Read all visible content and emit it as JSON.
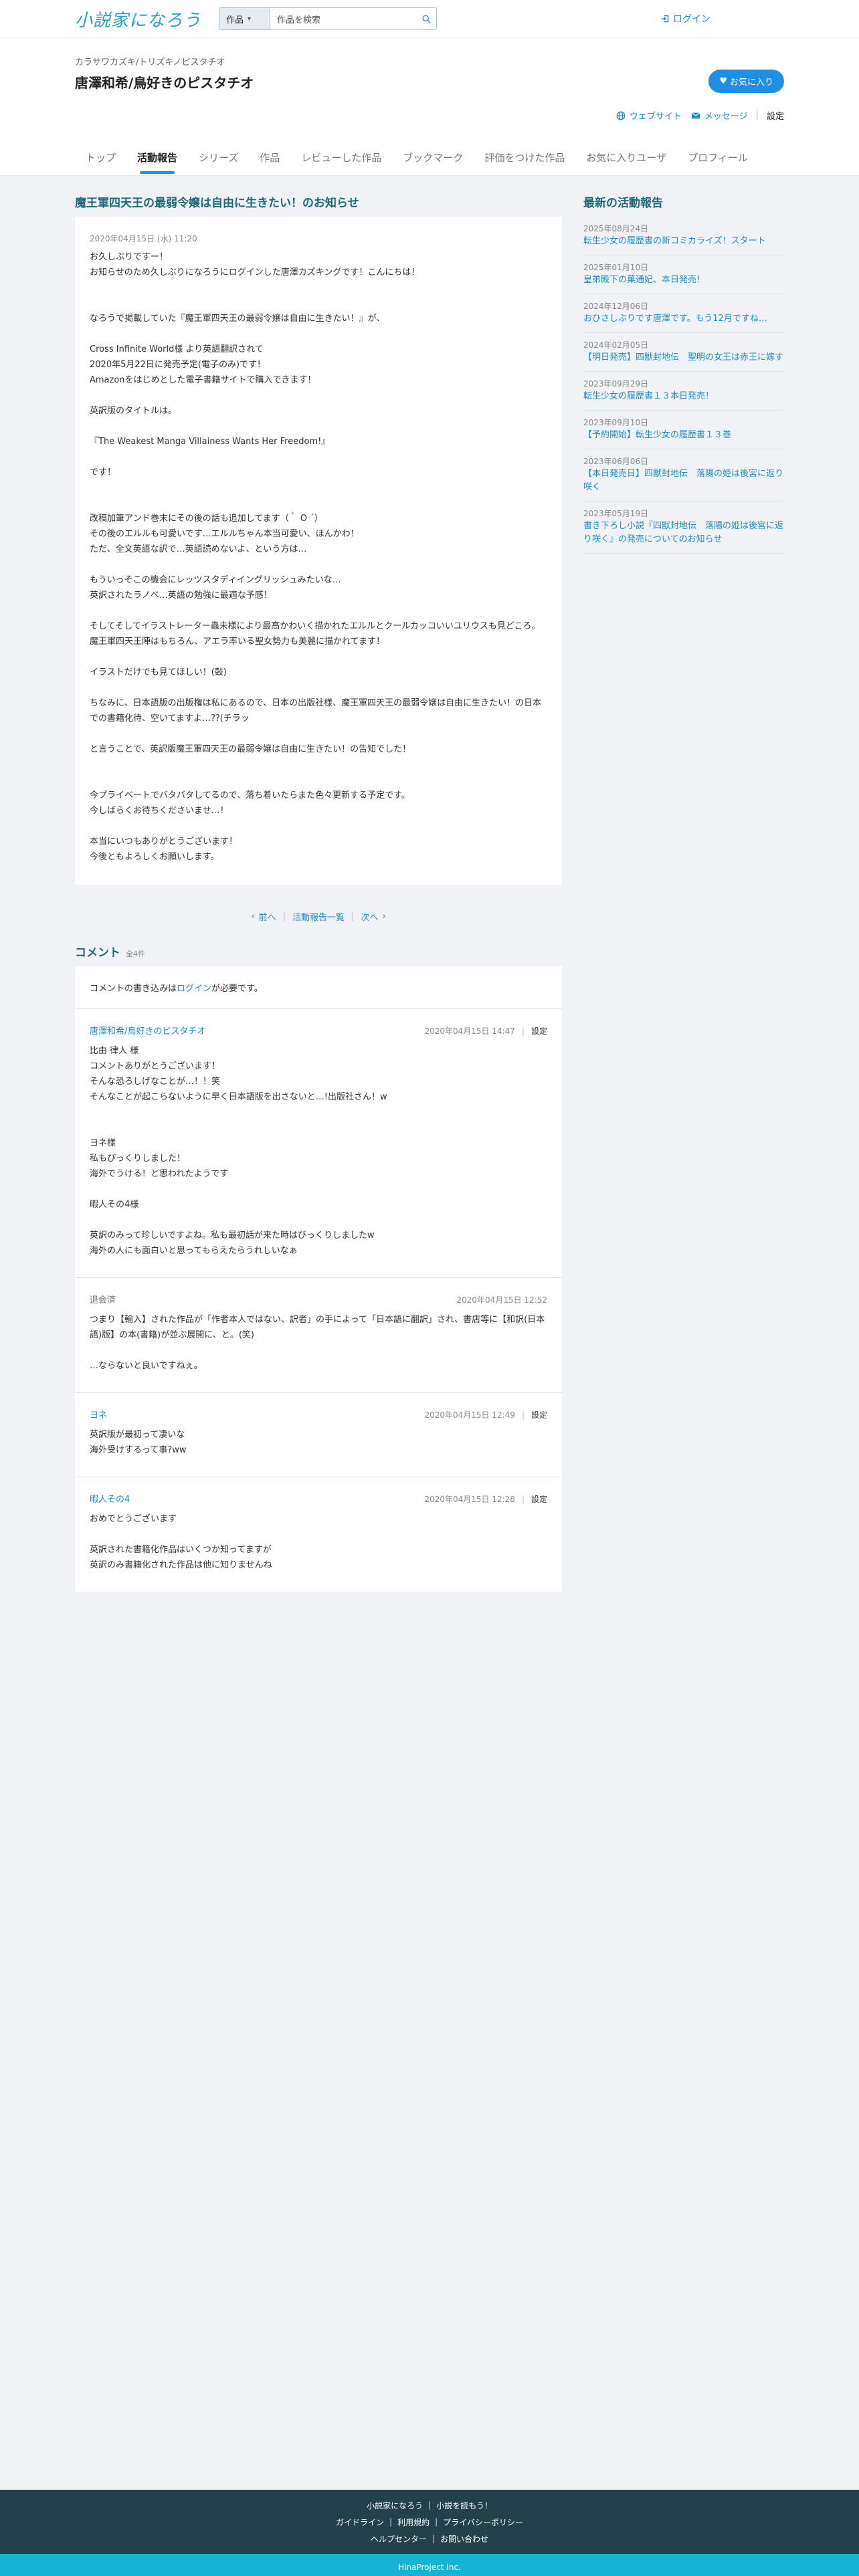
{
  "header": {
    "logo_small": "小説家",
    "logo_text": "小説家になろう",
    "search_category": "作品",
    "search_placeholder": "作品を検索",
    "login_label": "ログイン"
  },
  "user": {
    "ruby": "カラサワカズキ/トリズキノピスタチオ",
    "name": "唐澤和希/鳥好きのピスタチオ",
    "fav_label": "お気に入り",
    "website_label": "ウェブサイト",
    "message_label": "メッセージ",
    "settings_label": "設定",
    "tabs": [
      {
        "label": "トップ",
        "active": false
      },
      {
        "label": "活動報告",
        "active": true
      },
      {
        "label": "シリーズ",
        "active": false
      },
      {
        "label": "作品",
        "active": false
      },
      {
        "label": "レビューした作品",
        "active": false
      },
      {
        "label": "ブックマーク",
        "active": false
      },
      {
        "label": "評価をつけた作品",
        "active": false
      },
      {
        "label": "お気に入りユーザ",
        "active": false
      },
      {
        "label": "プロフィール",
        "active": false
      }
    ]
  },
  "report": {
    "title": "魔王軍四天王の最弱令嬢は自由に生きたい！のお知らせ",
    "date": "2020年04月15日 (水) 11:20",
    "lines": [
      "お久しぶりですー！",
      "お知らせのため久しぶりになろうにログインした唐澤カズキングです！こんにちは！",
      "",
      "",
      "なろうで掲載していた『魔王軍四天王の最弱令嬢は自由に生きたい！』が、",
      "",
      "Cross Infinite World様 より英語翻訳されて",
      "2020年5月22日に発売予定(電子のみ)です！",
      "Amazonをはじめとした電子書籍サイトで購入できます！",
      "",
      "英訳版のタイトルは。",
      "",
      "『The Weakest Manga Villainess Wants Her Freedom!』",
      "",
      "です！",
      "",
      "",
      "改稿加筆アンド巻末にその後の話も追加してます（｀ O ´）",
      "その後のエルルも可愛いです…エルルちゃん本当可愛い、ほんかわ！",
      "ただ、全文英語な訳で…英語読めないよ、という方は…",
      "",
      "もういっそこの機会にレッツスタディイングリッシュみたいな…",
      "英訳されたラノベ…英語の勉強に最適な予感！",
      "",
      "そしてそしてイラストレーター蟲未様により最高かわいく描かれたエルルとクールカッコいいユリウスも見どころ。",
      "魔王軍四天王陣はもちろん、アエラ率いる聖女勢力も美麗に描かれてます！",
      "",
      "イラストだけでも見てほしい！(鼓)",
      "",
      "ちなみに、日本語版の出版権は私にあるので、日本の出版社様、魔王軍四天王の最弱令嬢は自由に生きたい！の日本での書籍化待、空いてますよ…??(チラッ",
      "",
      "と言うことで、英訳版魔王軍四天王の最弱令嬢は自由に生きたい！の告知でした！",
      "",
      "",
      "今プライベートでバタバタしてるので、落ち着いたらまた色々更新する予定です。",
      "今しばらくお待ちくださいませ…！",
      "",
      "本当にいつもありがとうございます！",
      "今後ともよろしくお願いします。"
    ]
  },
  "pager": {
    "prev": "前へ",
    "list": "活動報告一覧",
    "next": "次へ"
  },
  "comments": {
    "title": "コメント",
    "count": "全4件",
    "notice_before": "コメントの書き込みは",
    "notice_link": "ログイン",
    "notice_after": "が必要です。",
    "items": [
      {
        "author": "唐澤和希/鳥好きのピスタチオ",
        "date": "2020年04月15日 14:47",
        "settings": "設定",
        "lines": [
          "比由 律人 様",
          "コメントありがとうございます！",
          "そんな恐ろしげなことが…！！笑",
          "そんなことが起こらないように早く日本語版を出さないと…!出版社さん！w",
          "",
          "",
          "ヨネ様",
          "私もびっくりしました！",
          "海外でうける！と思われたようです",
          "",
          "暇人その4様",
          "",
          "英訳のみって珍しいですよね。私も最初話が来た時はびっくりしましたw",
          "海外の人にも面白いと思ってもらえたらうれしいなぁ"
        ]
      },
      {
        "author": "退会済",
        "date": "2020年04月15日 12:52",
        "settings": "",
        "lines": [
          "つまり【輸入】された作品が「作者本人ではない、訳者」の手によって「日本語に翻訳」され、書店等に【和訳(日本語)版】の本(書籍)が並ぶ展開に、と。(笑)",
          "",
          "…ならないと良いですねぇ。"
        ]
      },
      {
        "author": "ヨネ",
        "date": "2020年04月15日 12:49",
        "settings": "設定",
        "lines": [
          "英訳版が最初って凄いな",
          "海外受けするって事?ww"
        ]
      },
      {
        "author": "暇人その4",
        "date": "2020年04月15日 12:28",
        "settings": "設定",
        "lines": [
          "おめでとうございます",
          "",
          "英訳された書籍化作品はいくつか知ってますが",
          "英訳のみ書籍化された作品は他に知りませんね"
        ]
      }
    ]
  },
  "sidebar": {
    "title": "最新の活動報告",
    "items": [
      {
        "date": "2025年08月24日",
        "title": "転生少女の履歴書の新コミカライズ！スタート"
      },
      {
        "date": "2025年01月10日",
        "title": "皇弟殿下の菓通妃、本日発売！"
      },
      {
        "date": "2024年12月06日",
        "title": "おひさしぶりです唐澤です。もう12月ですね…"
      },
      {
        "date": "2024年02月05日",
        "title": "【明日発売】四獣封地伝　聖明の女王は赤王に嫁す"
      },
      {
        "date": "2023年09月29日",
        "title": "転生少女の履歴書１３本日発売！"
      },
      {
        "date": "2023年09月10日",
        "title": "【予約開始】転生少女の履歴書１３巻"
      },
      {
        "date": "2023年06月06日",
        "title": "【本日発売日】四獣封地伝　落陽の姫は後宮に返り咲く"
      },
      {
        "date": "2023年05月19日",
        "title": "書き下ろし小説『四獣封地伝　落陽の姫は後宮に返り咲く』の発売についてのお知らせ"
      }
    ]
  },
  "footer": {
    "row1": [
      "小説家になろう",
      "小説を読もう！"
    ],
    "row2": [
      "ガイドライン",
      "利用規約",
      "プライバシーポリシー"
    ],
    "row3": [
      "ヘルプセンター",
      "お問い合わせ"
    ],
    "copyright": "HinaProject Inc."
  },
  "colors": {
    "accent": "#1f8fe5",
    "title_teal": "#1d6a78",
    "link": "#1a8ec9",
    "footer_bg": "#22414a",
    "copyright_bg": "#15b4d6"
  }
}
